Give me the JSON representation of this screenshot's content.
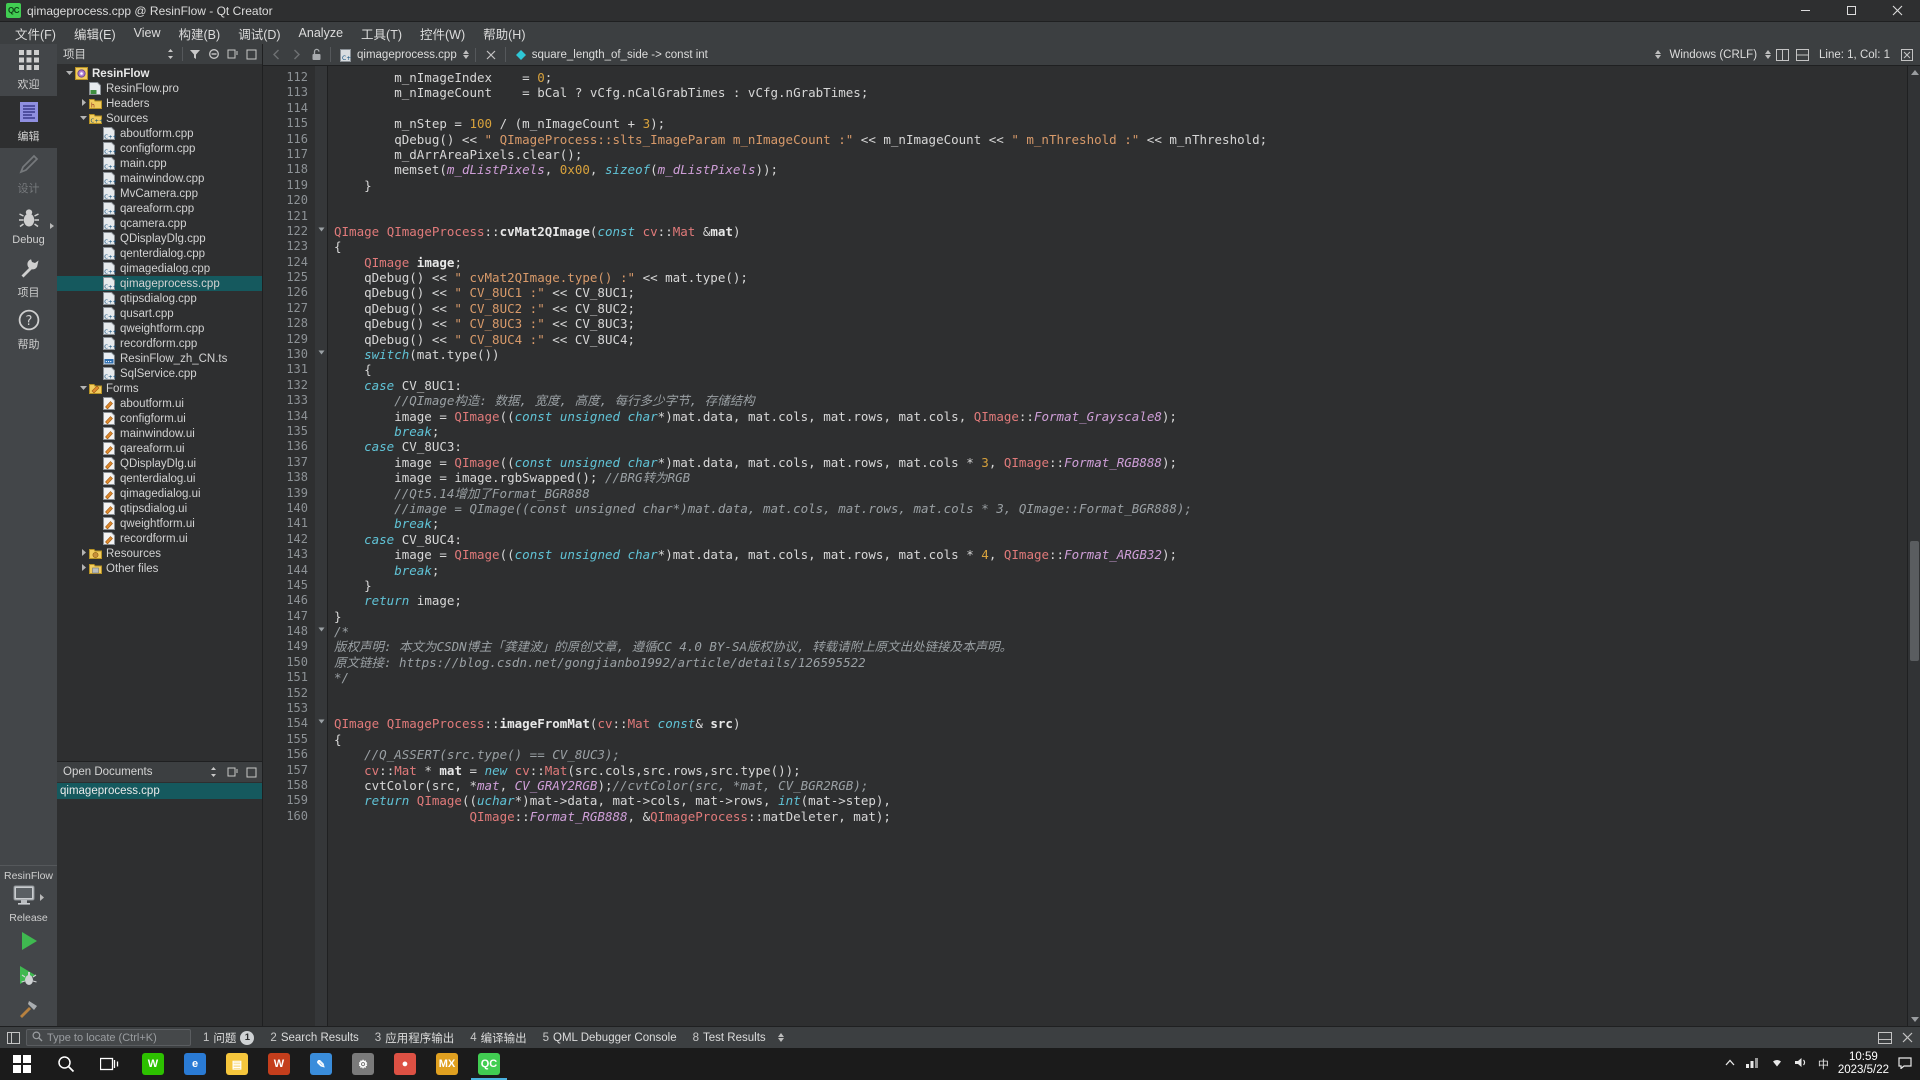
{
  "window": {
    "title": "qimageprocess.cpp @ ResinFlow - Qt Creator",
    "logo_text": "QC",
    "minimize": "—",
    "maximize": "☐",
    "close": "✕"
  },
  "menubar": [
    {
      "label": "文件(F)",
      "name": "menu-file"
    },
    {
      "label": "编辑(E)",
      "name": "menu-edit"
    },
    {
      "label": "View",
      "name": "menu-view"
    },
    {
      "label": "构建(B)",
      "name": "menu-build"
    },
    {
      "label": "调试(D)",
      "name": "menu-debug"
    },
    {
      "label": "Analyze",
      "name": "menu-analyze"
    },
    {
      "label": "工具(T)",
      "name": "menu-tools"
    },
    {
      "label": "控件(W)",
      "name": "menu-widgets"
    },
    {
      "label": "帮助(H)",
      "name": "menu-help"
    }
  ],
  "modebar": {
    "items": [
      {
        "label": "欢迎",
        "icon": "grid-icon",
        "name": "mode-welcome",
        "state": "normal"
      },
      {
        "label": "编辑",
        "icon": "document-icon",
        "name": "mode-edit",
        "state": "active"
      },
      {
        "label": "设计",
        "icon": "pencil-icon",
        "name": "mode-design",
        "state": "disabled"
      },
      {
        "label": "Debug",
        "icon": "bug-icon",
        "name": "mode-debug",
        "state": "normal"
      },
      {
        "label": "项目",
        "icon": "wrench-icon",
        "name": "mode-projects",
        "state": "normal"
      },
      {
        "label": "帮助",
        "icon": "question-icon",
        "name": "mode-help",
        "state": "normal"
      }
    ],
    "kit": {
      "project_name": "ResinFlow",
      "build_config": "Release",
      "icon": "monitor-icon",
      "run_icon": "run-arrow-icon",
      "debug_icon": "run-debug-icon",
      "build_icon": "hammer-icon"
    }
  },
  "sidepanel": {
    "project_header": {
      "title": "项目",
      "icons": [
        "sort-icon",
        "filter-icon",
        "sync-icon",
        "split-icon",
        "close-panel-icon"
      ]
    },
    "tree": [
      {
        "label": "ResinFlow",
        "indent": 0,
        "twisty": "down",
        "icon": "qt-project-icon",
        "root": true
      },
      {
        "label": "ResinFlow.pro",
        "indent": 1,
        "twisty": "",
        "icon": "pro-file-icon"
      },
      {
        "label": "Headers",
        "indent": 1,
        "twisty": "right",
        "icon": "folder-h-icon"
      },
      {
        "label": "Sources",
        "indent": 1,
        "twisty": "down",
        "icon": "folder-cpp-icon"
      },
      {
        "label": "aboutform.cpp",
        "indent": 2,
        "twisty": "",
        "icon": "cpp-file-icon"
      },
      {
        "label": "configform.cpp",
        "indent": 2,
        "twisty": "",
        "icon": "cpp-file-icon"
      },
      {
        "label": "main.cpp",
        "indent": 2,
        "twisty": "",
        "icon": "cpp-file-icon"
      },
      {
        "label": "mainwindow.cpp",
        "indent": 2,
        "twisty": "",
        "icon": "cpp-file-icon"
      },
      {
        "label": "MvCamera.cpp",
        "indent": 2,
        "twisty": "",
        "icon": "cpp-file-icon"
      },
      {
        "label": "qareaform.cpp",
        "indent": 2,
        "twisty": "",
        "icon": "cpp-file-icon"
      },
      {
        "label": "qcamera.cpp",
        "indent": 2,
        "twisty": "",
        "icon": "cpp-file-icon"
      },
      {
        "label": "QDisplayDlg.cpp",
        "indent": 2,
        "twisty": "",
        "icon": "cpp-file-icon"
      },
      {
        "label": "qenterdialog.cpp",
        "indent": 2,
        "twisty": "",
        "icon": "cpp-file-icon"
      },
      {
        "label": "qimagedialog.cpp",
        "indent": 2,
        "twisty": "",
        "icon": "cpp-file-icon"
      },
      {
        "label": "qimageprocess.cpp",
        "indent": 2,
        "twisty": "",
        "icon": "cpp-file-icon",
        "selected": true
      },
      {
        "label": "qtipsdialog.cpp",
        "indent": 2,
        "twisty": "",
        "icon": "cpp-file-icon"
      },
      {
        "label": "qusart.cpp",
        "indent": 2,
        "twisty": "",
        "icon": "cpp-file-icon"
      },
      {
        "label": "qweightform.cpp",
        "indent": 2,
        "twisty": "",
        "icon": "cpp-file-icon"
      },
      {
        "label": "recordform.cpp",
        "indent": 2,
        "twisty": "",
        "icon": "cpp-file-icon"
      },
      {
        "label": "ResinFlow_zh_CN.ts",
        "indent": 2,
        "twisty": "",
        "icon": "ts-file-icon"
      },
      {
        "label": "SqlService.cpp",
        "indent": 2,
        "twisty": "",
        "icon": "cpp-file-icon"
      },
      {
        "label": "Forms",
        "indent": 1,
        "twisty": "down",
        "icon": "folder-ui-icon"
      },
      {
        "label": "aboutform.ui",
        "indent": 2,
        "twisty": "",
        "icon": "ui-file-icon"
      },
      {
        "label": "configform.ui",
        "indent": 2,
        "twisty": "",
        "icon": "ui-file-icon"
      },
      {
        "label": "mainwindow.ui",
        "indent": 2,
        "twisty": "",
        "icon": "ui-file-icon"
      },
      {
        "label": "qareaform.ui",
        "indent": 2,
        "twisty": "",
        "icon": "ui-file-icon"
      },
      {
        "label": "QDisplayDlg.ui",
        "indent": 2,
        "twisty": "",
        "icon": "ui-file-icon"
      },
      {
        "label": "qenterdialog.ui",
        "indent": 2,
        "twisty": "",
        "icon": "ui-file-icon"
      },
      {
        "label": "qimagedialog.ui",
        "indent": 2,
        "twisty": "",
        "icon": "ui-file-icon"
      },
      {
        "label": "qtipsdialog.ui",
        "indent": 2,
        "twisty": "",
        "icon": "ui-file-icon"
      },
      {
        "label": "qweightform.ui",
        "indent": 2,
        "twisty": "",
        "icon": "ui-file-icon"
      },
      {
        "label": "recordform.ui",
        "indent": 2,
        "twisty": "",
        "icon": "ui-file-icon"
      },
      {
        "label": "Resources",
        "indent": 1,
        "twisty": "right",
        "icon": "folder-res-icon"
      },
      {
        "label": "Other files",
        "indent": 1,
        "twisty": "right",
        "icon": "folder-other-icon"
      }
    ],
    "open_documents": {
      "title": "Open Documents",
      "items": [
        {
          "label": "qimageprocess.cpp",
          "selected": true
        }
      ]
    }
  },
  "editor_toolbar": {
    "back_icon": "chevron-left-icon",
    "forward_icon": "chevron-right-icon",
    "lock_icon": "unlock-icon",
    "file_name": "qimageprocess.cpp",
    "close_icon": "close-document-icon",
    "symbol": "square_length_of_side -> const int",
    "symbol_icon": "variable-icon",
    "line_ending": "Windows (CRLF)",
    "cursor_position": "Line: 1, Col: 1",
    "split_icon": "split-editor-icon",
    "split_side_icon": "split-side-by-side-icon",
    "close_split_icon": "close-split-icon"
  },
  "code": {
    "first_line": 112,
    "lines": [
      {
        "n": 112,
        "fold": "",
        "html": "        m_nImageIndex    <op>=</op> <num>0</num>;"
      },
      {
        "n": 113,
        "fold": "",
        "html": "        m_nImageCount    <op>=</op> bCal ? vCfg.nCalGrabTimes : vCfg.nGrabTimes;"
      },
      {
        "n": 114,
        "fold": "",
        "html": ""
      },
      {
        "n": 115,
        "fold": "",
        "html": "        m_nStep <op>=</op> <num>100</num> / (m_nImageCount + <num>3</num>);"
      },
      {
        "n": 116,
        "fold": "",
        "html": "        qDebug() << <str>\" QImageProcess::slts_ImageParam m_nImageCount :\"</str> << m_nImageCount << <str>\" m_nThreshold :\"</str> << m_nThreshold;"
      },
      {
        "n": 117,
        "fold": "",
        "html": "        m_dArrAreaPixels.clear();"
      },
      {
        "n": 118,
        "fold": "",
        "html": "        memset(<fi>m_dListPixels</fi>, <num>0x00</num>, <ki>sizeof</ki>(<fi>m_dListPixels</fi>));"
      },
      {
        "n": 119,
        "fold": "",
        "html": "    }"
      },
      {
        "n": 120,
        "fold": "",
        "html": ""
      },
      {
        "n": 121,
        "fold": "",
        "html": ""
      },
      {
        "n": 122,
        "fold": "down",
        "html": "<ty>QImage</ty> <ty>QImageProcess</ty>::<fn>cvMat2QImage</fn>(<ki>const</ki> <ty>cv</ty>::<ty>Mat</ty> &<vb>mat</vb>)"
      },
      {
        "n": 123,
        "fold": "",
        "html": "{"
      },
      {
        "n": 124,
        "fold": "",
        "html": "    <ty>QImage</ty> <vb>image</vb>;"
      },
      {
        "n": 125,
        "fold": "",
        "html": "    qDebug() << <str>\" cvMat2QImage.type() :\"</str> << mat.type();"
      },
      {
        "n": 126,
        "fold": "",
        "html": "    qDebug() << <str>\" CV_8UC1 :\"</str> << CV_8UC1;"
      },
      {
        "n": 127,
        "fold": "",
        "html": "    qDebug() << <str>\" CV_8UC2 :\"</str> << CV_8UC2;"
      },
      {
        "n": 128,
        "fold": "",
        "html": "    qDebug() << <str>\" CV_8UC3 :\"</str> << CV_8UC3;"
      },
      {
        "n": 129,
        "fold": "",
        "html": "    qDebug() << <str>\" CV_8UC4 :\"</str> << CV_8UC4;"
      },
      {
        "n": 130,
        "fold": "down",
        "html": "    <ki>switch</ki>(mat.type())"
      },
      {
        "n": 131,
        "fold": "",
        "html": "    {"
      },
      {
        "n": 132,
        "fold": "",
        "html": "    <ki>case</ki> CV_8UC1:"
      },
      {
        "n": 133,
        "fold": "",
        "html": "        <cmt>//QImage构造: 数据, 宽度, 高度, 每行多少字节, 存储结构</cmt>"
      },
      {
        "n": 134,
        "fold": "",
        "html": "        image <op>=</op> <ty>QImage</ty>((<ki>const</ki> <ki>unsigned</ki> <ki>char</ki>*)mat.data, mat.cols, mat.rows, mat.cols, <ty>QImage</ty>::<fi>Format_Grayscale8</fi>);"
      },
      {
        "n": 135,
        "fold": "",
        "html": "        <ki>break</ki>;"
      },
      {
        "n": 136,
        "fold": "",
        "html": "    <ki>case</ki> CV_8UC3:"
      },
      {
        "n": 137,
        "fold": "",
        "html": "        image <op>=</op> <ty>QImage</ty>((<ki>const</ki> <ki>unsigned</ki> <ki>char</ki>*)mat.data, mat.cols, mat.rows, mat.cols * <num>3</num>, <ty>QImage</ty>::<fi>Format_RGB888</fi>);"
      },
      {
        "n": 138,
        "fold": "",
        "html": "        image <op>=</op> image.rgbSwapped(); <cmt>//BRG转为RGB</cmt>"
      },
      {
        "n": 139,
        "fold": "",
        "html": "        <cmt>//Qt5.14增加了Format_BGR888</cmt>"
      },
      {
        "n": 140,
        "fold": "",
        "html": "        <cmt>//image = QImage((const unsigned char*)mat.data, mat.cols, mat.rows, mat.cols * 3, QImage::Format_BGR888);</cmt>"
      },
      {
        "n": 141,
        "fold": "",
        "html": "        <ki>break</ki>;"
      },
      {
        "n": 142,
        "fold": "",
        "html": "    <ki>case</ki> CV_8UC4:"
      },
      {
        "n": 143,
        "fold": "",
        "html": "        image <op>=</op> <ty>QImage</ty>((<ki>const</ki> <ki>unsigned</ki> <ki>char</ki>*)mat.data, mat.cols, mat.rows, mat.cols * <num>4</num>, <ty>QImage</ty>::<fi>Format_ARGB32</fi>);"
      },
      {
        "n": 144,
        "fold": "",
        "html": "        <ki>break</ki>;"
      },
      {
        "n": 145,
        "fold": "",
        "html": "    }"
      },
      {
        "n": 146,
        "fold": "",
        "html": "    <ki>return</ki> image;"
      },
      {
        "n": 147,
        "fold": "",
        "html": "}"
      },
      {
        "n": 148,
        "fold": "down",
        "html": "<cmt>/*</cmt>"
      },
      {
        "n": 149,
        "fold": "",
        "html": "<cmt>版权声明: 本文为CSDN博主「龚建波」的原创文章, 遵循CC 4.0 BY-SA版权协议, 转载请附上原文出处链接及本声明。</cmt>"
      },
      {
        "n": 150,
        "fold": "",
        "html": "<cmt>原文链接: https://blog.csdn.net/gongjianbo1992/article/details/126595522</cmt>"
      },
      {
        "n": 151,
        "fold": "",
        "html": "<cmt>*/</cmt>"
      },
      {
        "n": 152,
        "fold": "",
        "html": ""
      },
      {
        "n": 153,
        "fold": "",
        "html": ""
      },
      {
        "n": 154,
        "fold": "down",
        "html": "<ty>QImage</ty> <ty>QImageProcess</ty>::<fn>imageFromMat</fn>(<ty>cv</ty>::<ty>Mat</ty> <ki>const</ki>& <vb>src</vb>)"
      },
      {
        "n": 155,
        "fold": "",
        "html": "{"
      },
      {
        "n": 156,
        "fold": "",
        "html": "    <cmt>//Q_ASSERT(src.type() == CV_8UC3);</cmt>"
      },
      {
        "n": 157,
        "fold": "",
        "html": "    <ty>cv</ty>::<ty>Mat</ty> * <vb>mat</vb> <op>=</op> <ki>new</ki> <ty>cv</ty>::<ty>Mat</ty>(src.cols,src.rows,src.type());"
      },
      {
        "n": 158,
        "fold": "",
        "html": "    cvtColor(src, *<fi>mat</fi>, <fi>CV_GRAY2RGB</fi>);<cmt>//cvtColor(src, *mat, CV_BGR2RGB);</cmt>"
      },
      {
        "n": 159,
        "fold": "",
        "html": "    <ki>return</ki> <ty>QImage</ty>((<ki>uchar</ki>*)mat->data, mat->cols, mat->rows, <ki>int</ki>(mat->step),"
      },
      {
        "n": 160,
        "fold": "",
        "html": "                  <ty>QImage</ty>::<fi>Format_RGB888</fi>, &<ty>QImageProcess</ty>::matDeleter, mat);"
      }
    ]
  },
  "statusbar": {
    "locator_placeholder": "Type to locate (Ctrl+K)",
    "search_icon": "search-icon",
    "outputs": [
      {
        "num": "1",
        "label": "问题",
        "badge": "1",
        "name": "output-issues"
      },
      {
        "num": "2",
        "label": "Search Results",
        "badge": "",
        "name": "output-search-results"
      },
      {
        "num": "3",
        "label": "应用程序输出",
        "badge": "",
        "name": "output-application"
      },
      {
        "num": "4",
        "label": "编译输出",
        "badge": "",
        "name": "output-compile"
      },
      {
        "num": "5",
        "label": "QML Debugger Console",
        "badge": "",
        "name": "output-qml-console"
      },
      {
        "num": "8",
        "label": "Test Results",
        "badge": "",
        "name": "output-test-results"
      }
    ]
  },
  "taskbar": {
    "start_icon": "windows-start-icon",
    "search_icon": "taskbar-search-icon",
    "taskview_icon": "task-view-icon",
    "apps": [
      {
        "name": "taskbar-app-wechat",
        "glyph": "W",
        "color": "#2dc100",
        "active": false
      },
      {
        "name": "taskbar-app-edge",
        "glyph": "e",
        "color": "#2a7bd5",
        "active": false
      },
      {
        "name": "taskbar-app-explorer",
        "glyph": "▤",
        "color": "#f6c63c",
        "active": false
      },
      {
        "name": "taskbar-app-word",
        "glyph": "W",
        "color": "#c43e1c",
        "active": false
      },
      {
        "name": "taskbar-app-notes",
        "glyph": "✎",
        "color": "#3a8ddb",
        "active": false
      },
      {
        "name": "taskbar-app-tool",
        "glyph": "⚙",
        "color": "#7a7a7a",
        "active": false
      },
      {
        "name": "taskbar-app-chrome",
        "glyph": "●",
        "color": "#dd5144",
        "active": false
      },
      {
        "name": "taskbar-app-mx",
        "glyph": "MX",
        "color": "#e0a020",
        "active": false
      },
      {
        "name": "taskbar-app-qtcreator",
        "glyph": "QC",
        "color": "#41cd52",
        "active": true
      }
    ],
    "tray": {
      "up_icon": "show-hidden-icons",
      "network_icon": "network-icon",
      "wifi_icon": "wifi-icon",
      "volume_icon": "volume-icon",
      "ime": "中",
      "time": "10:59",
      "date": "2023/5/22",
      "notification_icon": "action-center-icon"
    }
  }
}
